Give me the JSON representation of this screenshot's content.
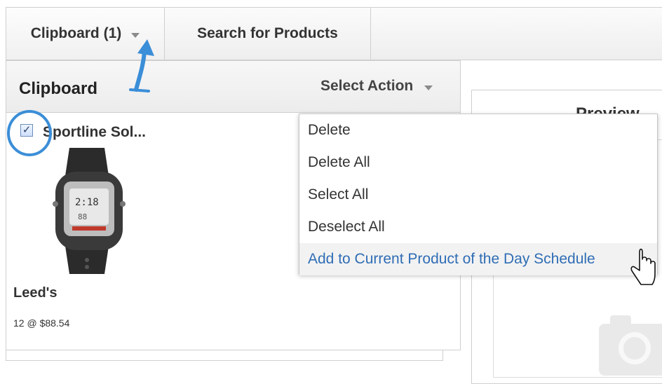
{
  "tabs": [
    {
      "label": "Clipboard (1)",
      "has_caret": true
    },
    {
      "label": "Search for Products",
      "has_caret": false
    }
  ],
  "clipboard": {
    "title": "Clipboard",
    "select_action_label": "Select Action",
    "items": [
      {
        "checked": true,
        "title": "Sportline Sol...",
        "seller": "Leed's",
        "price": "12 @ $88.54"
      }
    ]
  },
  "action_menu": {
    "items": [
      {
        "label": "Delete"
      },
      {
        "label": "Delete All"
      },
      {
        "label": "Select All"
      },
      {
        "label": "Deselect All"
      },
      {
        "label": "Add to Current Product of the Day Schedule",
        "hovered": true
      }
    ]
  },
  "preview": {
    "title": "Preview"
  },
  "colors": {
    "accent": "#2f6db5",
    "annotation": "#3b8ed8"
  },
  "icons": [
    "caret-down-icon",
    "checkbox-icon",
    "watch-image",
    "camera-placeholder-icon",
    "hand-cursor-icon",
    "arrow-annotation"
  ]
}
